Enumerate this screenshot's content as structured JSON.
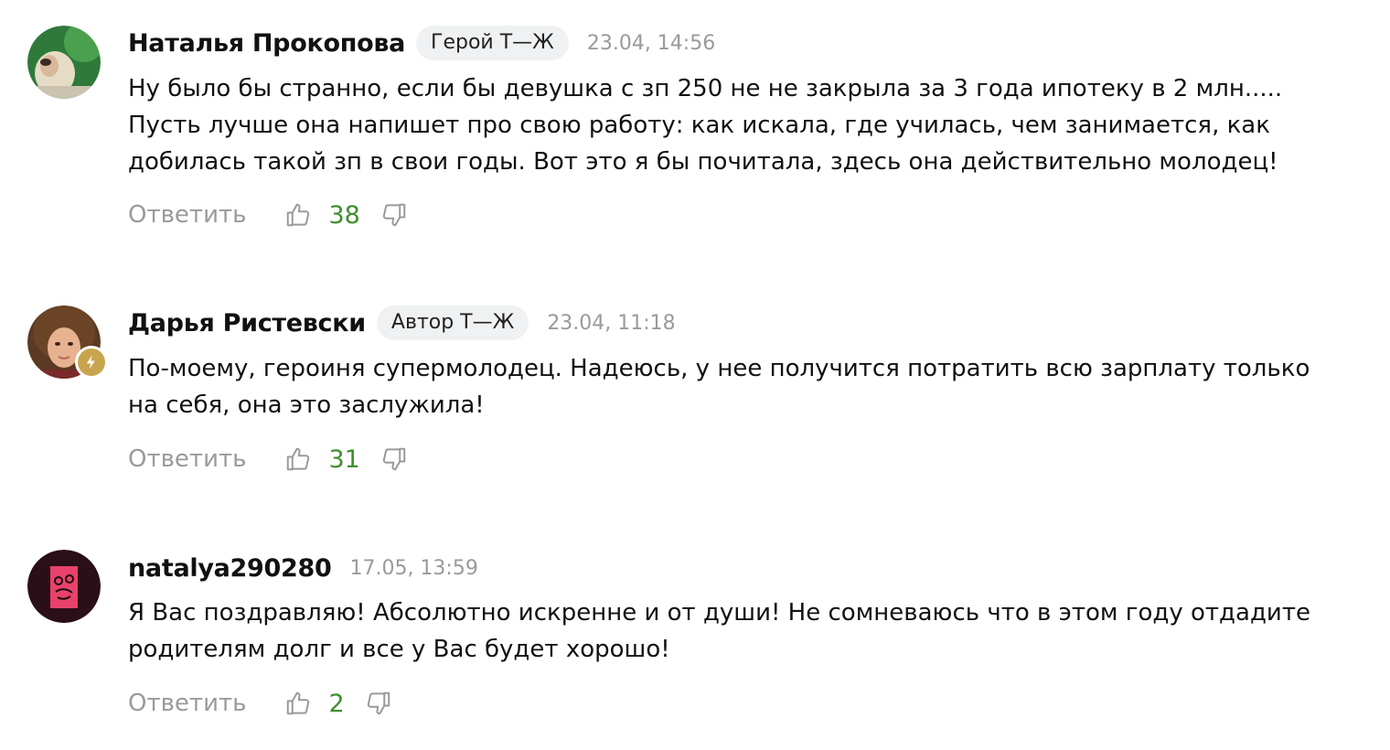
{
  "comments": [
    {
      "author": "Наталья Прокопова",
      "role_badge": "Герой Т—Ж",
      "date": "23.04, 14:56",
      "text": "Ну было бы странно, если бы девушка с зп 250 не не закрыла за 3 года ипотеку в 2 млн.....\nПусть лучше она напишет про свою работу: как искала, где училась, чем занимается, как\nдобилась такой зп в свои годы. Вот это я бы почитала, здесь она действительно молодец!",
      "reply_label": "Ответить",
      "likes": "38",
      "avatar_icon": "user-photo-green"
    },
    {
      "author": "Дарья Ристевски",
      "role_badge": "Автор Т—Ж",
      "date": "23.04, 11:18",
      "text": "По-моему, героиня супермолодец. Надеюсь, у нее получится потратить всю зарплату только\nна себя, она это заслужила!",
      "reply_label": "Ответить",
      "likes": "31",
      "avatar_icon": "user-photo-woman",
      "author_badge_icon": "author-lightning-icon"
    },
    {
      "author": "natalya290280",
      "date": "17.05, 13:59",
      "text": "Я Вас поздравляю! Абсолютно искренне и от души! Не сомневаюсь что в этом году отдадите\nродителям долг и все у Вас будет хорошо!",
      "reply_label": "Ответить",
      "likes": "2",
      "avatar_icon": "user-avatar-pink-face"
    }
  ],
  "colors": {
    "text": "#111111",
    "muted": "#9a9a9a",
    "likes": "#3f8f2e",
    "badge_bg": "#f0f1f2",
    "author_badge": "#c9a44f"
  }
}
